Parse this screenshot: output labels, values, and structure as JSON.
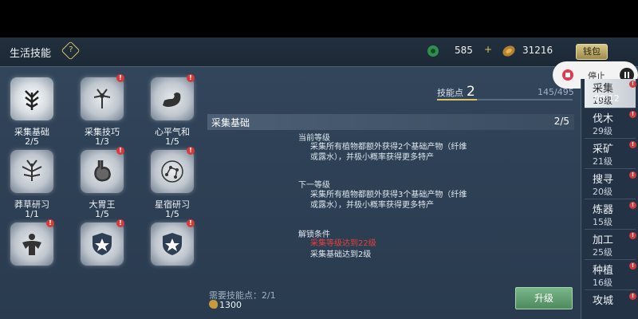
{
  "header": {
    "title": "生活技能",
    "help_label": "?",
    "jade_amount": "585",
    "coin_amount": "31216",
    "plus_label": "+",
    "wallet_label": "钱包"
  },
  "skill_points": {
    "label": "技能点",
    "value": "2",
    "count": "145/495",
    "progress": 0.293
  },
  "recording": {
    "label": "停止",
    "timer": "00:12"
  },
  "skills": [
    {
      "name": "采集基础",
      "level": "2/5",
      "icon": "leaf-icon",
      "badge": ""
    },
    {
      "name": "采集技巧",
      "level": "1/3",
      "icon": "flower-icon",
      "badge": "!"
    },
    {
      "name": "心平气和",
      "level": "1/5",
      "icon": "arm-icon",
      "badge": "!"
    },
    {
      "name": "莽草研习",
      "level": "1/1",
      "icon": "herb-icon",
      "badge": ""
    },
    {
      "name": "大胃王",
      "level": "1/5",
      "icon": "stomach-icon",
      "badge": "!"
    },
    {
      "name": "星宿研习",
      "level": "1/5",
      "icon": "constellation-icon",
      "badge": "!"
    },
    {
      "name": "",
      "level": "",
      "icon": "muscle-icon",
      "badge": "!"
    },
    {
      "name": "",
      "level": "",
      "icon": "star-shield-icon",
      "badge": "!"
    },
    {
      "name": "",
      "level": "",
      "icon": "star-shield-icon",
      "badge": "!"
    }
  ],
  "detail": {
    "title": "采集基础",
    "level": "2/5",
    "current_label": "当前等级",
    "current_desc": "采集所有植物都额外获得2个基础产物（纤维或露水），并极小概率获得更多特产",
    "next_label": "下一等级",
    "next_desc": "采集所有植物都额外获得3个基础产物（纤维或露水），并极小概率获得更多特产",
    "unlock_label": "解锁条件",
    "unlock_1": "采集等级达到22级",
    "unlock_2": "采集基础达到2级",
    "need_label": "需要技能点：2/1",
    "cost": "1300",
    "upgrade_label": "升级"
  },
  "sidebar": [
    {
      "name": "采集",
      "level": "19级",
      "badge": "!"
    },
    {
      "name": "伐木",
      "level": "29级",
      "badge": "!"
    },
    {
      "name": "采矿",
      "level": "21级",
      "badge": "!"
    },
    {
      "name": "搜寻",
      "level": "20级",
      "badge": "!"
    },
    {
      "name": "炼器",
      "level": "15级",
      "badge": "!"
    },
    {
      "name": "加工",
      "level": "25级",
      "badge": "!"
    },
    {
      "name": "种植",
      "level": "16级",
      "badge": "!"
    },
    {
      "name": "攻城",
      "level": "",
      "badge": "!"
    }
  ],
  "colors": {
    "accent": "#d8c36a",
    "warning": "#e2403f",
    "upgrade": "#5f9f6f"
  }
}
